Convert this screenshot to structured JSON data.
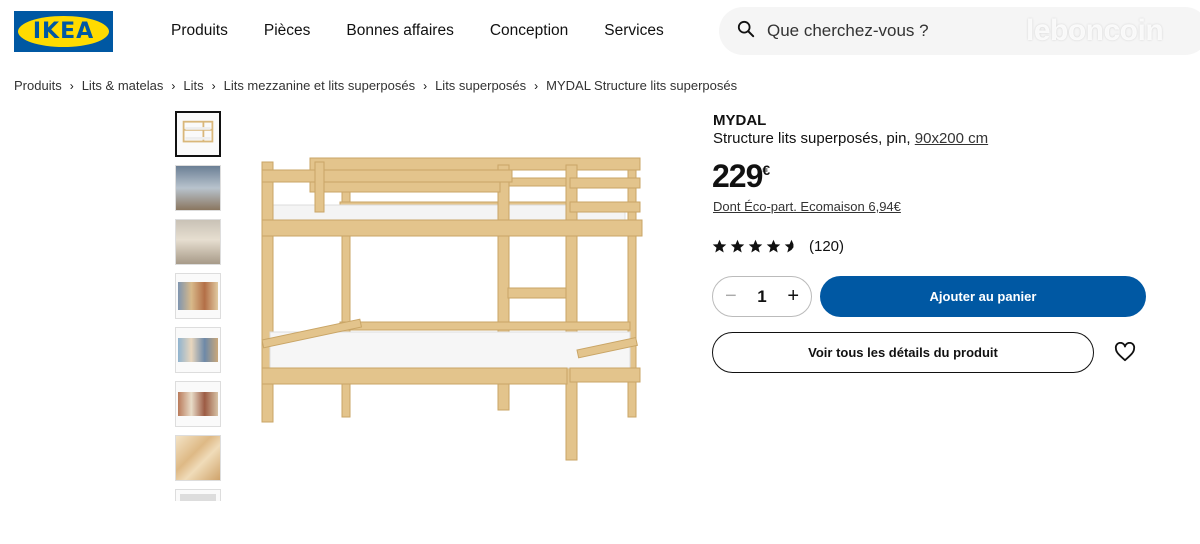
{
  "brand": {
    "logo_text": "IKEA",
    "blue": "#0058a3",
    "yellow": "#ffdb00"
  },
  "nav": [
    "Produits",
    "Pièces",
    "Bonnes affaires",
    "Conception",
    "Services"
  ],
  "search": {
    "placeholder": "Que cherchez-vous ?",
    "icon": "search-icon"
  },
  "watermark": "leboncoin",
  "breadcrumb": [
    "Produits",
    "Lits & matelas",
    "Lits",
    "Lits mezzanine et lits superposés",
    "Lits superposés",
    "MYDAL Structure lits superposés"
  ],
  "product": {
    "name": "MYDAL",
    "description": "Structure lits superposés, pin,",
    "size": "90x200 cm",
    "price": "229",
    "currency": "€",
    "eco": "Dont Éco-part. Ecomaison 6,94€",
    "rating": 4.5,
    "rating_max": 5,
    "reviews": "(120)"
  },
  "cart": {
    "quantity": "1",
    "minus": "−",
    "plus": "+",
    "add_label": "Ajouter au panier"
  },
  "details_label": "Voir tous les détails du produit",
  "thumbnail_count": 8
}
